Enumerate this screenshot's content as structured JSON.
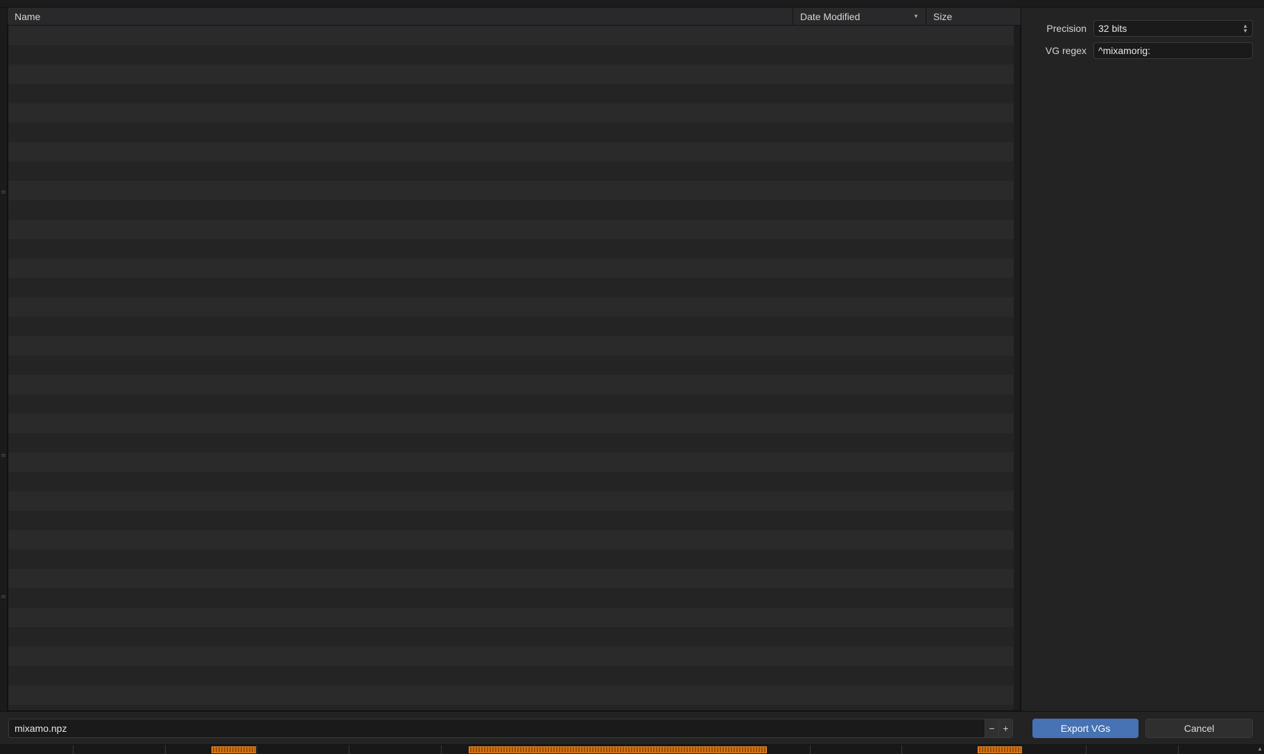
{
  "browser": {
    "columns": {
      "name": "Name",
      "date": "Date Modified",
      "size": "Size"
    },
    "filename_value": "mixamo.npz",
    "step_minus": "−",
    "step_plus": "+"
  },
  "sidebar": {
    "precision_label": "Precision",
    "precision_value": "32 bits",
    "vg_regex_label": "VG regex",
    "vg_regex_value": "^mixamorig:"
  },
  "actions": {
    "export": "Export VGs",
    "cancel": "Cancel"
  }
}
